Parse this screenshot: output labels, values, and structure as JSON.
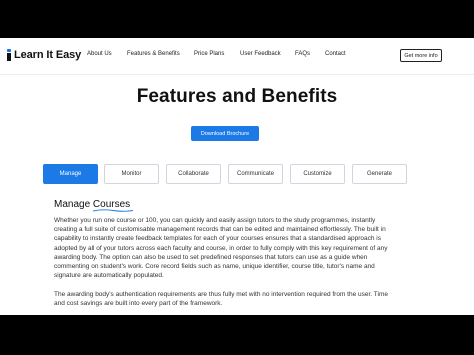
{
  "brand": {
    "name": "Learn It Easy",
    "accent": "#1c7ae6"
  },
  "nav": {
    "links": [
      "About Us",
      "Features & Benefits",
      "Price Plans",
      "User Feedback",
      "FAQs",
      "Contact"
    ],
    "cta": "Get more info"
  },
  "hero": {
    "title": "Features and Benefits",
    "button": "Download Brochure"
  },
  "tabs": {
    "items": [
      "Manage",
      "Monitor",
      "Collaborate",
      "Communicate",
      "Customize",
      "Generate"
    ],
    "active": "Manage"
  },
  "section": {
    "title_prefix": "Manage ",
    "title_word": "Courses",
    "paragraphs": [
      "Whether you run one course or 100, you can quickly and easily assign tutors to the study programmes, instantly creating a full suite of customisable management records that can be edited and maintained effortlessly. The built in capability to instantly create feedback templates for each of your courses ensures that a standardised approach is adopted by all of your tutors across each faculty and course, in order to fully comply with this key requirement of any awarding body. The option can also be used to set predefined responses that tutors can use as a guide when commenting on student's work. Core record fields such as name, unique identifier, course title, tutor's name and signature are automatically populated.",
      "The awarding body's authentication requirements are thus fully met with no intervention required from the user. Time and cost savings are built into every part of the framework."
    ]
  }
}
